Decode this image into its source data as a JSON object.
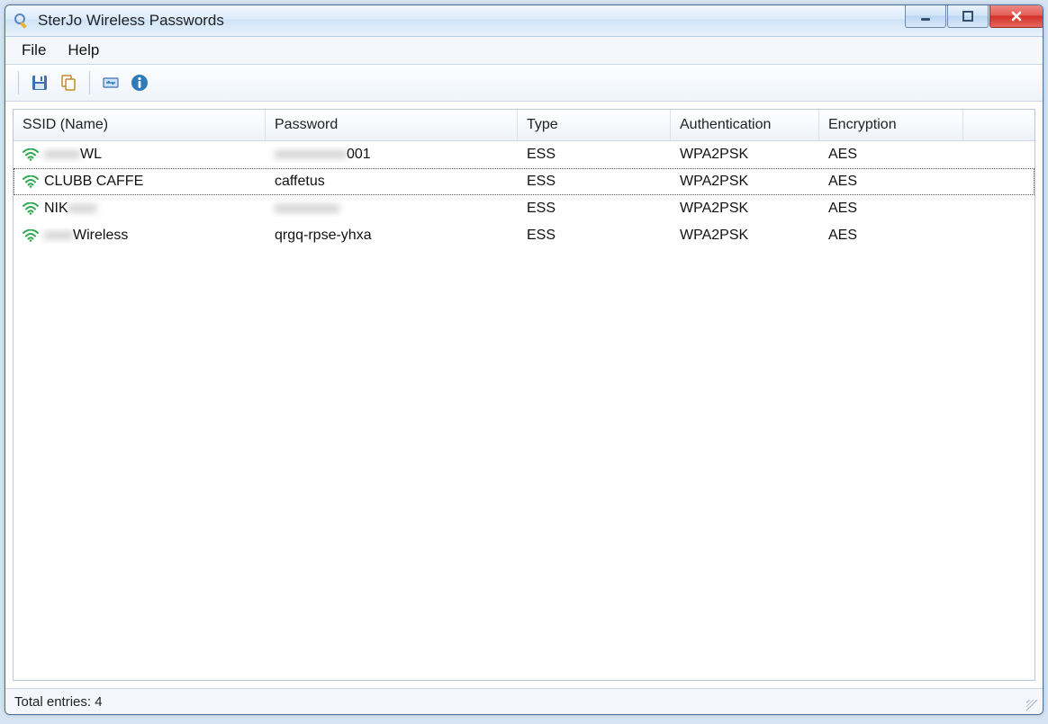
{
  "window": {
    "title": "SterJo Wireless Passwords"
  },
  "menu": {
    "file": "File",
    "help": "Help"
  },
  "toolbar": {
    "save": "save-icon",
    "copy": "copy-icon",
    "refresh": "refresh-icon",
    "about": "about-icon"
  },
  "columns": {
    "ssid": "SSID (Name)",
    "password": "Password",
    "type": "Type",
    "auth": "Authentication",
    "enc": "Encryption"
  },
  "rows": [
    {
      "ssid_prefix_hidden": "xxxxx",
      "ssid_suffix": "WL",
      "password_prefix_hidden": "xxxxxxxxxx",
      "password_suffix": "001",
      "type": "ESS",
      "auth": "WPA2PSK",
      "enc": "AES",
      "selected": false
    },
    {
      "ssid": "CLUBB CAFFE",
      "password": "caffetus",
      "type": "ESS",
      "auth": "WPA2PSK",
      "enc": "AES",
      "selected": true
    },
    {
      "ssid_prefix": "NIK",
      "ssid_suffix_hidden": "xxxx",
      "password_hidden": "xxxxxxxxx",
      "type": "ESS",
      "auth": "WPA2PSK",
      "enc": "AES",
      "selected": false
    },
    {
      "ssid_prefix_hidden": "xxxx",
      "ssid_suffix": "Wireless",
      "password": "qrgq-rpse-yhxa",
      "type": "ESS",
      "auth": "WPA2PSK",
      "enc": "AES",
      "selected": false
    }
  ],
  "status": {
    "text": "Total entries: 4"
  }
}
